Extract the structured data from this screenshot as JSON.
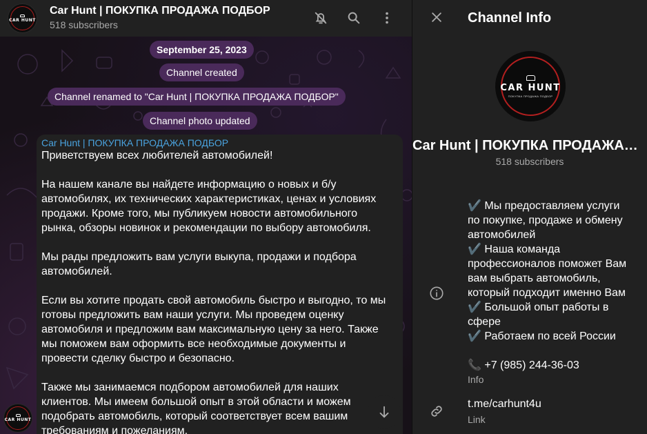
{
  "header": {
    "title": "Car Hunt | ПОКУПКА ПРОДАЖА ПОДБОР",
    "subscribers": "518 subscribers",
    "mute_icon": "bell-off-icon",
    "search_icon": "search-icon",
    "menu_icon": "more-vertical-icon"
  },
  "logo": {
    "brand": "CAR HUNT",
    "tagline": "ПОКУПКА ПРОДАЖА ПОДБОР"
  },
  "service_messages": {
    "date": "September 25, 2023",
    "created": "Channel created",
    "renamed": "Channel renamed to \"Car Hunt | ПОКУПКА ПРОДАЖА ПОДБОР\"",
    "photo_updated": "Channel photo updated"
  },
  "message": {
    "author": "Car Hunt | ПОКУПКА ПРОДАЖА ПОДБОР",
    "paragraphs": [
      [
        "Приветствуем всех любителей автомобилей!"
      ],
      [
        "На нашем канале вы найдете информацию о новых и б/у",
        "автомобилях, их технических характеристиках, ценах и условиях",
        "продажи. Кроме того, мы публикуем новости автомобильного",
        "рынка, обзоры новинок и рекомендации по выбору автомобиля."
      ],
      [
        "Мы рады предложить вам услуги выкупа, продажи и подбора",
        "автомобилей."
      ],
      [
        "Если вы хотите продать свой автомобиль быстро и выгодно, то мы",
        "готовы предложить вам наши услуги. Мы проведем оценку",
        "автомобиля и предложим вам максимальную цену за него. Также",
        "мы поможем вам оформить все необходимые документы и",
        "провести сделку быстро и безопасно."
      ],
      [
        "Также мы занимаемся подбором автомобилей для наших",
        "клиентов. Мы имеем большой опыт в этой области и можем",
        "подобрать автомобиль, который соответствует всем вашим",
        "требованиям и пожеланиям."
      ]
    ]
  },
  "scroll_down_icon": "arrow-down-icon",
  "info_panel": {
    "title": "Channel Info",
    "close_icon": "close-icon",
    "name": "Car Hunt | ПОКУПКА ПРОДАЖА ПОДБОР",
    "subscribers": "518 subscribers",
    "description_lines": [
      "✔️  Мы предоставляем услуги",
      "по покупке, продаже и обмену",
      "автомобилей",
      "✔️  Наша команда",
      "профессионалов поможет Вам",
      "вам выбрать автомобиль,",
      "который подходит именно Вам",
      "✔️ Большой опыт работы в",
      "сфере",
      "✔️ Работаем по всей России",
      "",
      "📞  +7 (985) 244-36-03"
    ],
    "description_label": "Info",
    "info_icon": "info-icon",
    "link_value": "t.me/carhunt4u",
    "link_label": "Link",
    "link_icon": "link-icon"
  }
}
